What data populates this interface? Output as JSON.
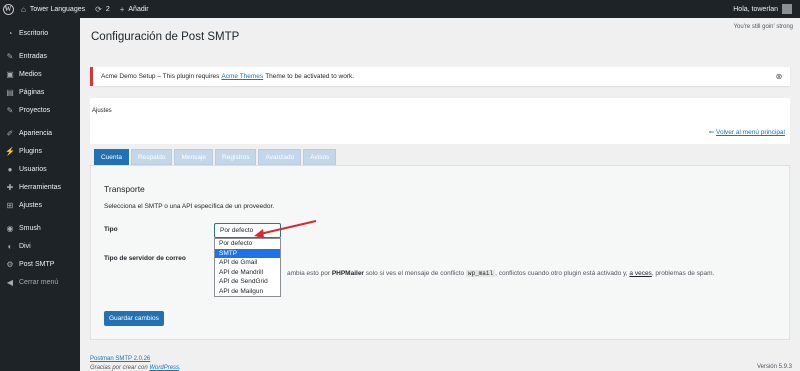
{
  "adminbar": {
    "site_name": "Tower Languages",
    "updates_count": "2",
    "new_label": "Añadir",
    "greeting": "Hola, towerlan"
  },
  "sidebar": {
    "items": [
      {
        "label": "Escritorio",
        "icon": "dashboard-icon"
      },
      {
        "label": "Entradas",
        "icon": "pin-icon"
      },
      {
        "label": "Medios",
        "icon": "media-icon"
      },
      {
        "label": "Páginas",
        "icon": "pages-icon"
      },
      {
        "label": "Proyectos",
        "icon": "pin-icon"
      },
      {
        "label": "Apariencia",
        "icon": "brush-icon"
      },
      {
        "label": "Plugins",
        "icon": "plugin-icon"
      },
      {
        "label": "Usuarios",
        "icon": "user-icon"
      },
      {
        "label": "Herramientas",
        "icon": "wrench-icon"
      },
      {
        "label": "Ajustes",
        "icon": "settings-icon"
      },
      {
        "label": "Smush",
        "icon": "smush-icon"
      },
      {
        "label": "Divi",
        "icon": "divi-icon"
      },
      {
        "label": "Post SMTP",
        "icon": "gear-icon"
      },
      {
        "label": "Cerrar menú",
        "icon": "collapse-icon"
      }
    ]
  },
  "header": {
    "fun_text": "You're still goin' strong",
    "title": "Configuración de Post SMTP"
  },
  "notice": {
    "prefix": "Acme Demo Setup – This plugin requires",
    "link": "Acme Themes",
    "suffix": "Theme to be activated to work."
  },
  "panel": {
    "title": "Ajustes",
    "back_link": "Volver al menú principal"
  },
  "tabs": [
    "Cuenta",
    "Respaldo",
    "Mensaje",
    "Registros",
    "Avanzado",
    "Avisos"
  ],
  "transport": {
    "title": "Transporte",
    "description": "Selecciona el SMTP o una API específica de un proveedor.",
    "type_label": "Tipo",
    "server_label": "Tipo de servidor de correo",
    "selected": "Por defecto",
    "options": [
      "Por defecto",
      "SMTP",
      "API de Gmail",
      "API de Mandrill",
      "API de SendGrid",
      "API de Mailgun"
    ],
    "highlighted_option": "SMTP",
    "help_pre": "ambia esto por",
    "help_bold": "PHPMailer",
    "help_mid": "solo si ves el mensaje de conflicto",
    "help_code": "wp_mail",
    "help_mid2": ", conflictos cuando otro plugin está activado y,",
    "help_underline": "a veces",
    "help_end": ", problemas de spam.",
    "save_label": "Guardar cambios"
  },
  "footer": {
    "plugin_version": "Postman SMTP 2.0.26",
    "thanks": "Gracias por crear con",
    "wp_link": "WordPress",
    "version": "Versión 5.9.3"
  },
  "colors": {
    "adminbar_bg": "#1d2327",
    "accent": "#2271b1",
    "notice_error": "#d63638",
    "arrow": "#e0262e"
  }
}
